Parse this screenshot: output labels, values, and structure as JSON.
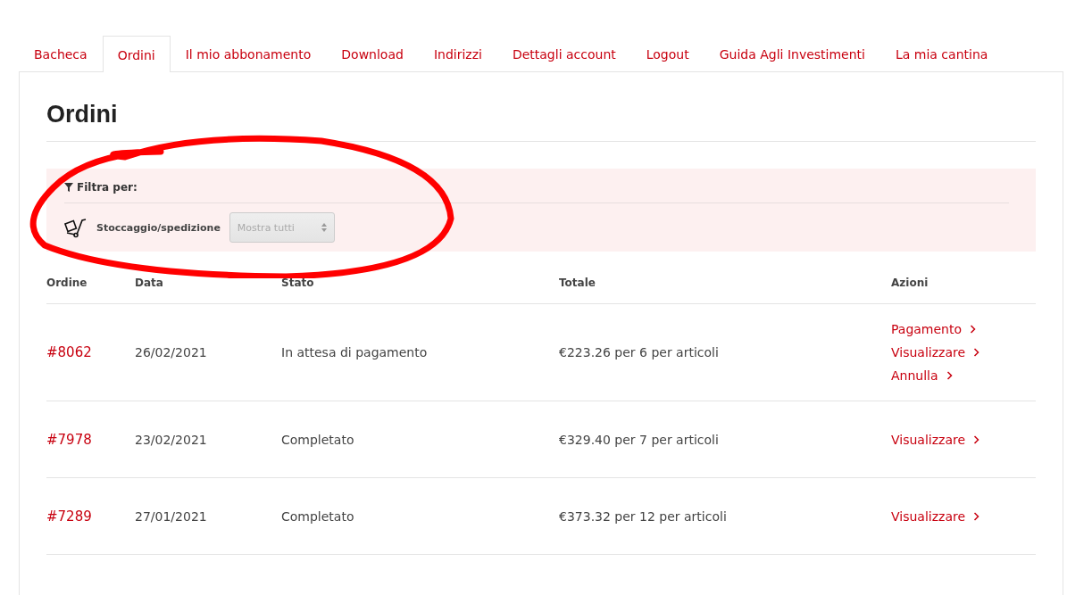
{
  "tabs": [
    {
      "label": "Bacheca",
      "selected": false
    },
    {
      "label": "Ordini",
      "selected": true
    },
    {
      "label": "Il mio abbonamento",
      "selected": false
    },
    {
      "label": "Download",
      "selected": false
    },
    {
      "label": "Indirizzi",
      "selected": false
    },
    {
      "label": "Dettagli account",
      "selected": false
    },
    {
      "label": "Logout",
      "selected": false
    },
    {
      "label": "Guida Agli Investimenti",
      "selected": false
    },
    {
      "label": "La mia cantina",
      "selected": false
    }
  ],
  "title": "Ordini",
  "filter": {
    "heading": "Filtra per:",
    "label": "Stoccaggio/spedizione",
    "select_value": "Mostra tutti"
  },
  "table": {
    "columns": [
      "Ordine",
      "Data",
      "Stato",
      "Totale",
      "Azioni"
    ],
    "rows": [
      {
        "order": "#8062",
        "date": "26/02/2021",
        "status": "In attesa di pagamento",
        "total": "€223.26 per 6 per articoli",
        "actions": [
          "Pagamento",
          "Visualizzare",
          "Annulla"
        ]
      },
      {
        "order": "#7978",
        "date": "23/02/2021",
        "status": "Completato",
        "total": "€329.40 per 7 per articoli",
        "actions": [
          "Visualizzare"
        ]
      },
      {
        "order": "#7289",
        "date": "27/01/2021",
        "status": "Completato",
        "total": "€373.32 per 12 per articoli",
        "actions": [
          "Visualizzare"
        ]
      }
    ]
  }
}
